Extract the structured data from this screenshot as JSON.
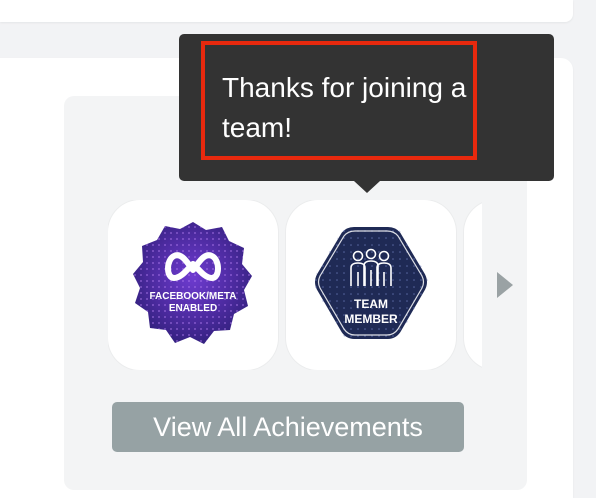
{
  "tooltip": {
    "text": "Thanks for joining a team!"
  },
  "achievements": {
    "badges": [
      {
        "name": "facebook-meta-enabled",
        "label_line1": "FACEBOOK/META",
        "label_line2": "ENABLED",
        "colors": {
          "primary": "#3d2a8c",
          "accent": "#8b4fd8"
        }
      },
      {
        "name": "team-member",
        "label_line1": "TEAM",
        "label_line2": "MEMBER",
        "colors": {
          "primary": "#1f2a55",
          "border": "#ffffff"
        }
      }
    ],
    "view_all_label": "View All Achievements"
  },
  "colors": {
    "tooltip_bg": "#333333",
    "highlight": "#e8290e",
    "button_bg": "#96a2a4"
  },
  "icons": {
    "next": "chevron-right-icon",
    "meta": "meta-infinity-icon",
    "team": "team-people-icon"
  }
}
